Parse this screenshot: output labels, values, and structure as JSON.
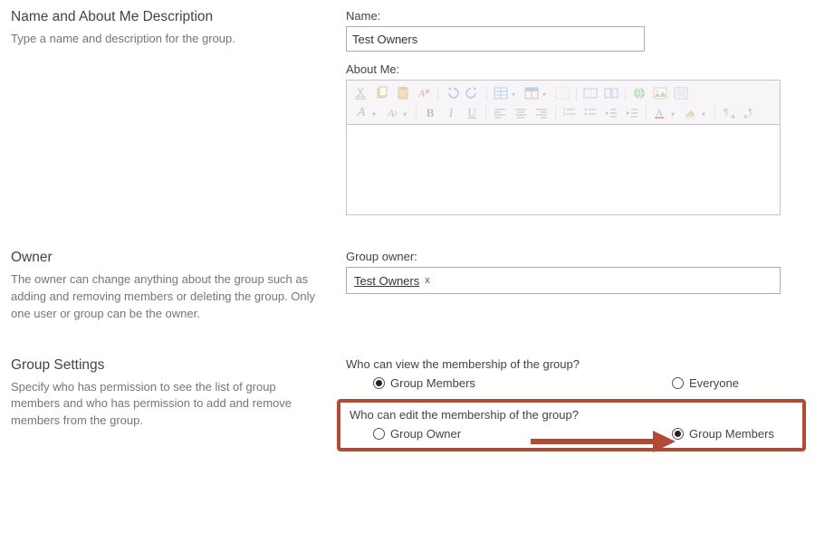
{
  "section1": {
    "title": "Name and About Me Description",
    "desc": "Type a name and description for the group.",
    "name_label": "Name:",
    "name_value": "Test Owners",
    "about_label": "About Me:"
  },
  "section2": {
    "title": "Owner",
    "desc": "The owner can change anything about the group such as adding and removing members or deleting the group. Only one user or group can be the owner.",
    "owner_label": "Group owner:",
    "owner_value": "Test Owners",
    "owner_remove": "x"
  },
  "section3": {
    "title": "Group Settings",
    "desc": "Specify who has permission to see the list of group members and who has permission to add and remove members from the group.",
    "q_view": "Who can view the membership of the group?",
    "view_opt1": "Group Members",
    "view_opt2": "Everyone",
    "q_edit": "Who can edit the membership of the group?",
    "edit_opt1": "Group Owner",
    "edit_opt2": "Group Members"
  },
  "rte": {
    "r1": {
      "cut": "cut-icon",
      "copy": "copy-icon",
      "paste": "paste-icon",
      "clear": "clear-format-icon",
      "undo": "undo-icon",
      "redo": "redo-icon",
      "table": "insert-table-icon",
      "tablestyle": "table-style-icon",
      "showgrid": "show-grid-icon",
      "merge": "merge-icon",
      "split": "split-icon",
      "link": "link-icon",
      "image": "image-icon",
      "media": "media-icon"
    },
    "r2": {
      "font": "font-icon",
      "size": "font-size-icon",
      "bold": "bold-icon",
      "italic": "italic-icon",
      "underline": "underline-icon",
      "jl": "justify-left-icon",
      "jc": "justify-center-icon",
      "jr": "justify-right-icon",
      "nl": "numbered-list-icon",
      "bl": "bullet-list-icon",
      "out": "outdent-icon",
      "ind": "indent-icon",
      "color": "text-color-icon",
      "hl": "highlight-icon",
      "ltr": "ltr-icon",
      "rtl": "rtl-icon"
    }
  }
}
